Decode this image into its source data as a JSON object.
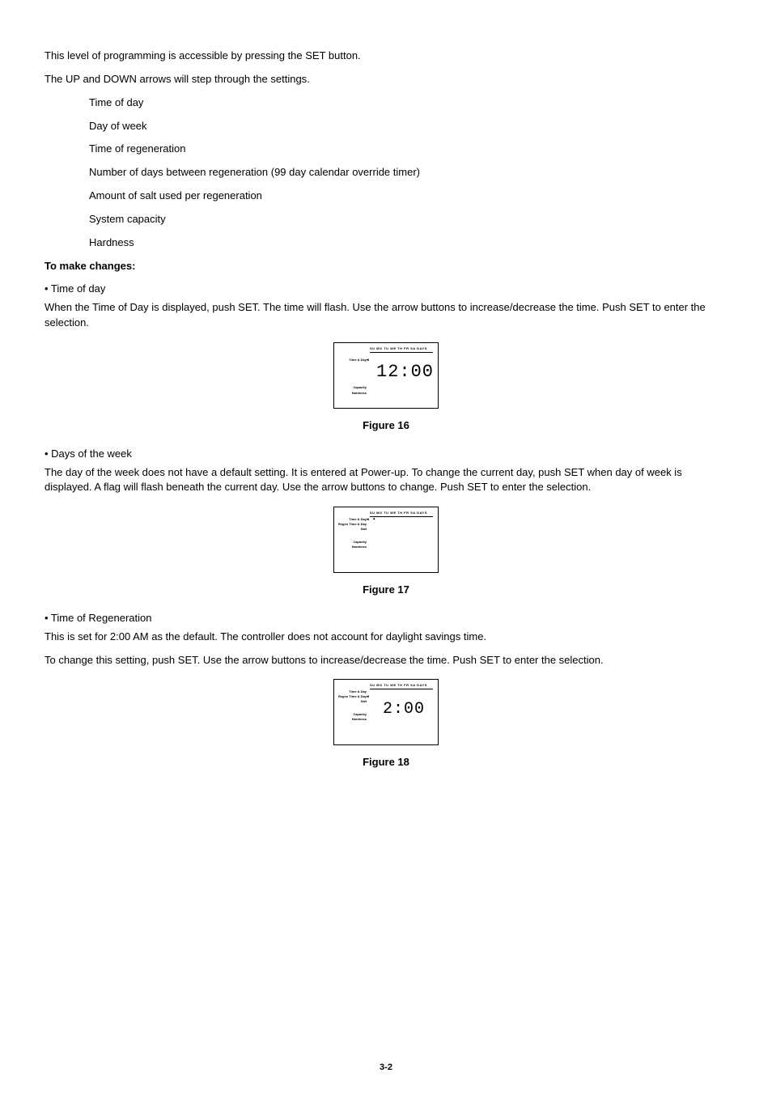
{
  "p1": "This level of programming is accessible by pressing the SET button.",
  "p2": "The UP and DOWN arrows will step through the settings.",
  "list": {
    "i1": "Time of day",
    "i2": "Day of week",
    "i3": "Time of regeneration",
    "i4": "Number of days between regeneration (99 day calendar override timer)",
    "i5": "Amount of salt used per regeneration",
    "i6": "System capacity",
    "i7": "Hardness"
  },
  "h_changes": "To make changes:",
  "b1": "• Time of day",
  "b1_text": "When the Time of Day is displayed, push SET.  The time will flash.  Use the arrow buttons to increase/decrease the time.  Push SET to enter the selection.",
  "fig16": {
    "days": "SU  MO  TU  WE  TH  FR  SA DAYS",
    "left_line1": "Time & Day",
    "left_line4": "Capacity",
    "left_line5": "Hardness",
    "pointer": "◂",
    "digits": "12:00",
    "caption": "Figure 16"
  },
  "b2": "• Days of the week",
  "b2_text": "The day of the week does not have a default setting.  It is entered at Power-up.  To change the current day, push SET when day of week is displayed.  A flag will flash beneath the current day.  Use the arrow buttons to change.  Push SET to enter the selection.",
  "fig17": {
    "days": "SU  MO  TU  WE  TH  FR  SA  DAYS",
    "left_line1": "Time & Day",
    "left_line2": "Regen Time & Day",
    "left_line3": "Salt",
    "left_line4": "Capacity",
    "left_line5": "Hardness",
    "pointer": "◂",
    "flag": "▴",
    "caption": "Figure 17"
  },
  "b3": "• Time of Regeneration",
  "b3_text1": "This is set for 2:00 AM as the default.  The controller does not account for daylight savings time.",
  "b3_text2": "To change this setting, push SET.  Use the arrow buttons to increase/decrease the time.  Push SET to enter the selection.",
  "fig18": {
    "days": "SU  MO  TU  WE  TH  FR  SA  DAYS",
    "left_line1": "Time & Day",
    "left_line2": "Regen Time & Day",
    "left_line3": "Salt",
    "left_line4": "Capacity",
    "left_line5": "Hardness",
    "pointer": "◂",
    "digits": "2:00",
    "caption": "Figure 18"
  },
  "page_number": "3-2"
}
